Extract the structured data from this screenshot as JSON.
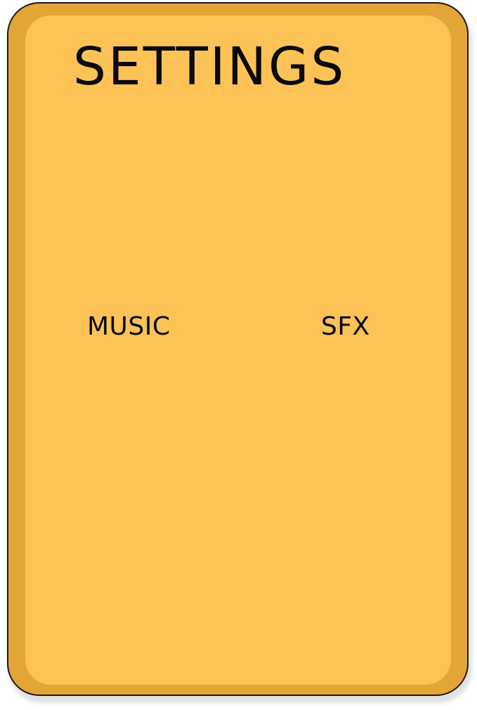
{
  "settings": {
    "title": "SETTINGS",
    "options": {
      "music_label": "MUSIC",
      "sfx_label": "SFX"
    }
  },
  "colors": {
    "panel_border": "#e3a636",
    "panel_fill": "#fcc256",
    "outline": "#1a1a1a",
    "text": "#0a0a0a"
  }
}
